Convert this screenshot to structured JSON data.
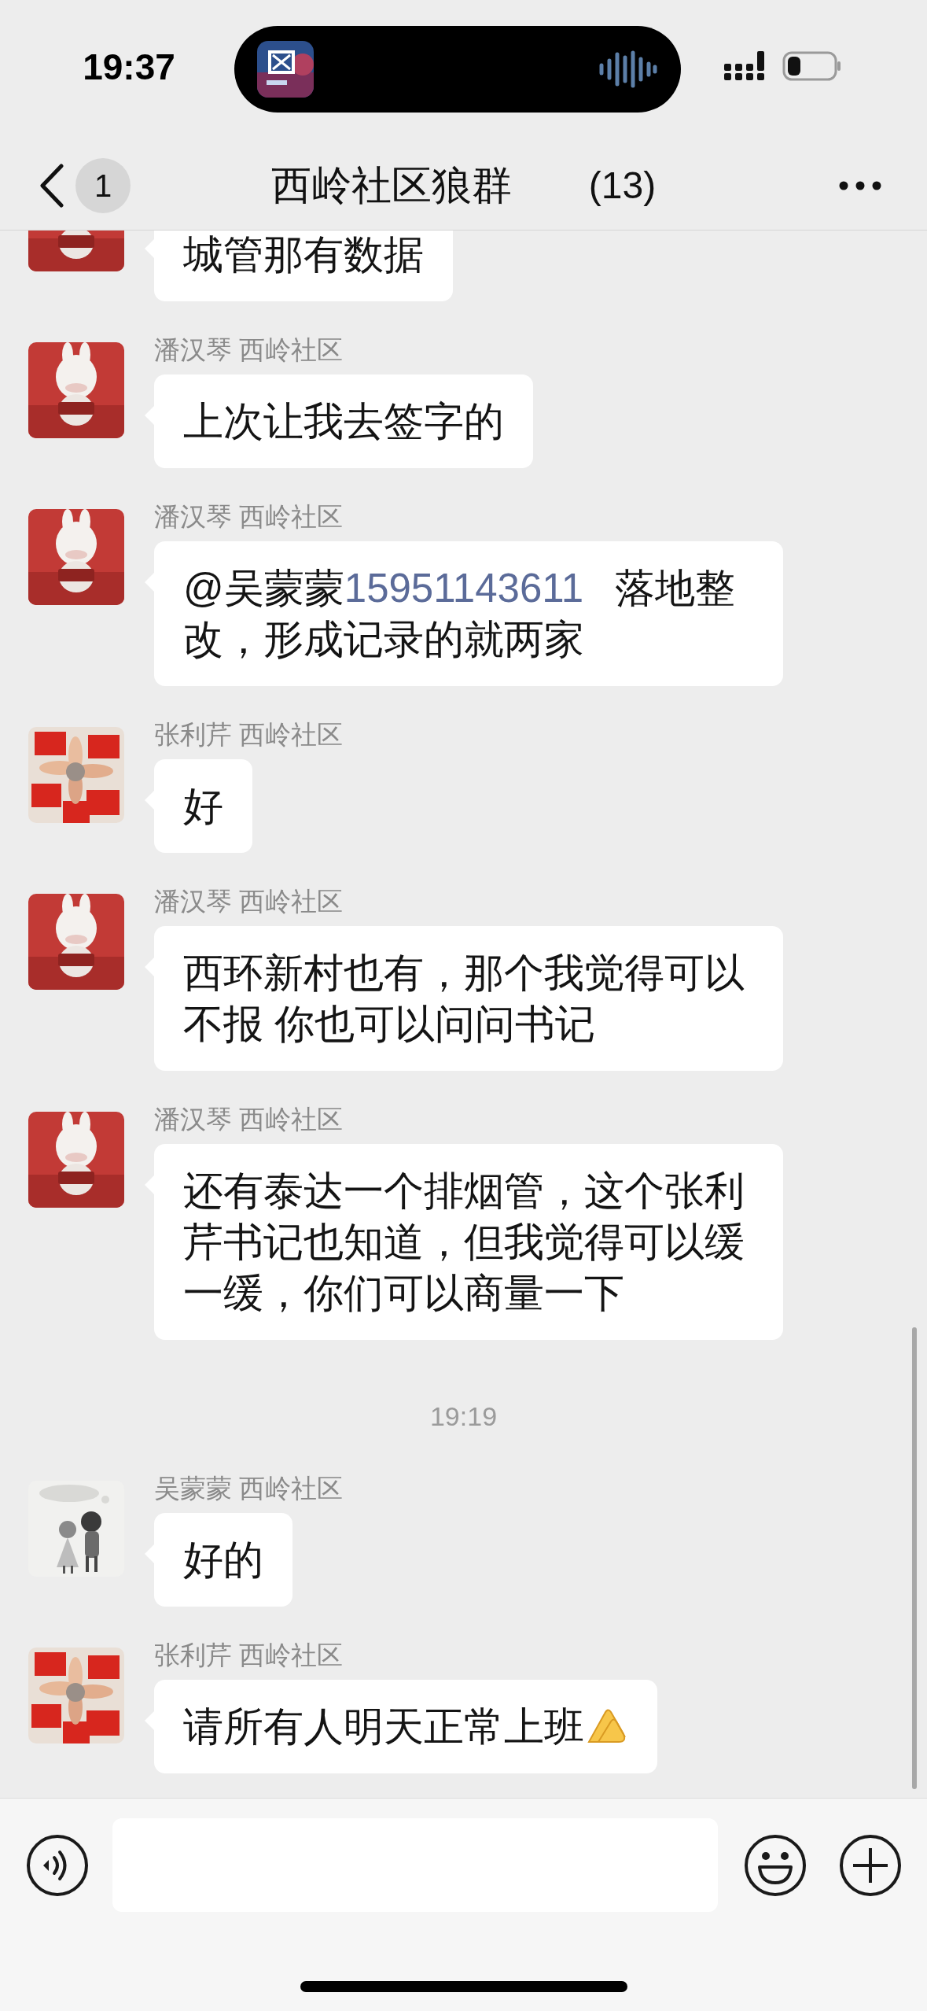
{
  "status_bar": {
    "time": "19:37"
  },
  "header": {
    "badge": "1",
    "title": "西岭社区狼群",
    "member_count": "(13)"
  },
  "items": [
    {
      "kind": "message",
      "parts": [
        {
          "kind": "text",
          "text": "城管那有数据"
        }
      ]
    },
    {
      "kind": "message",
      "sender": "潘汉琴 西岭社区",
      "parts": [
        {
          "kind": "text",
          "text": "上次让我去签字的"
        }
      ]
    },
    {
      "kind": "message",
      "sender": "潘汉琴 西岭社区",
      "parts": [
        {
          "kind": "text",
          "text": "@吴蒙蒙"
        },
        {
          "kind": "link",
          "text": "15951143611"
        },
        {
          "kind": "text",
          "text": "落地整改，形成记录的就两家"
        }
      ]
    },
    {
      "kind": "message",
      "sender": "张利芹 西岭社区",
      "parts": [
        {
          "kind": "text",
          "text": "好"
        }
      ]
    },
    {
      "kind": "message",
      "sender": "潘汉琴 西岭社区",
      "parts": [
        {
          "kind": "text",
          "text": "西环新村也有，那个我觉得可以不报 你也可以问问书记"
        }
      ]
    },
    {
      "kind": "message",
      "sender": "潘汉琴 西岭社区",
      "parts": [
        {
          "kind": "text",
          "text": "还有泰达一个排烟管，这个张利芹书记也知道，但我觉得可以缓一缓，你们可以商量一下"
        }
      ]
    },
    {
      "kind": "time",
      "text": "19:19"
    },
    {
      "kind": "message",
      "sender": "吴蒙蒙 西岭社区",
      "parts": [
        {
          "kind": "text",
          "text": "好的"
        }
      ]
    },
    {
      "kind": "message",
      "sender": "张利芹 西岭社区",
      "parts": [
        {
          "kind": "text",
          "text": "请所有人明天正常上班"
        },
        {
          "kind": "hand_emoji"
        }
      ]
    }
  ]
}
